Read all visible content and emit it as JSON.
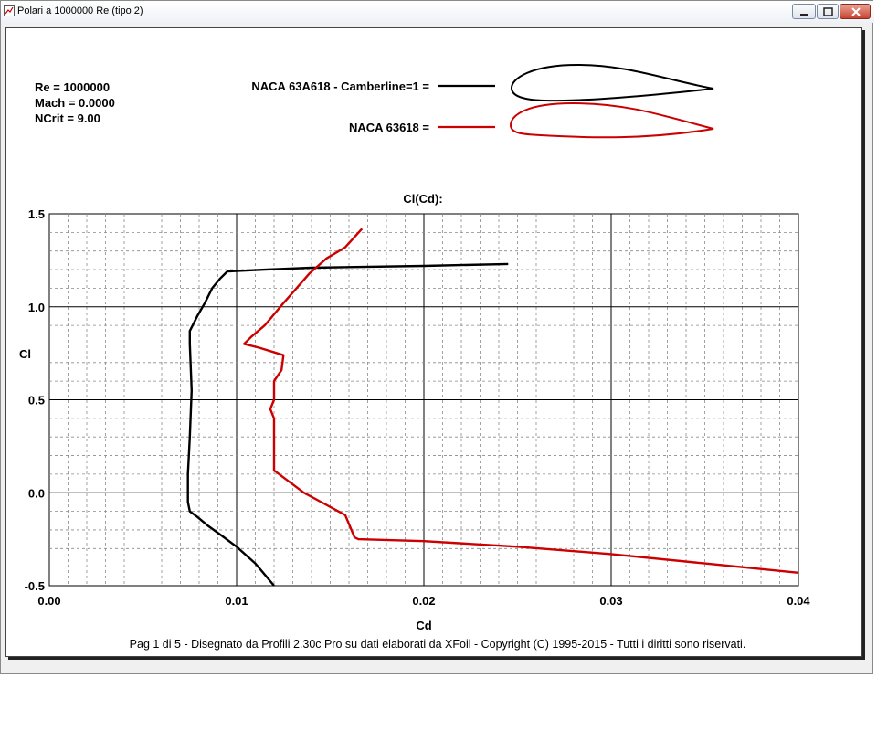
{
  "window": {
    "title": "Polari a 1000000 Re (tipo 2)",
    "controls": [
      "minimize",
      "maximize",
      "close"
    ]
  },
  "conditions": {
    "re": "Re = 1000000",
    "mach": "Mach = 0.0000",
    "ncrit": "NCrit = 9.00"
  },
  "legend": [
    {
      "label": "NACA 63A618 - Camberline=1 =",
      "color": "#000000"
    },
    {
      "label": "NACA 63618 =",
      "color": "#cc0000"
    }
  ],
  "footer": "Pag 1 di 5  -   Disegnato da Profili 2.30c Pro su dati elaborati da XFoil - Copyright (C) 1995-2015 - Tutti i diritti sono riservati.",
  "chart_data": {
    "type": "line",
    "title": "Cl(Cd):",
    "xlabel": "Cd",
    "ylabel": "Cl",
    "xlim": [
      0,
      0.04
    ],
    "ylim": [
      -0.5,
      1.5
    ],
    "x_ticks": [
      "0.00",
      "0.01",
      "0.02",
      "0.03",
      "0.04"
    ],
    "y_ticks": [
      "1.5",
      "1.0",
      "0.5",
      "0.0",
      "-0.5"
    ],
    "grid": true,
    "series": [
      {
        "name": "NACA 63A618 - Camberline=1",
        "color": "#000000",
        "points": [
          [
            0.012,
            -0.5
          ],
          [
            0.0115,
            -0.44
          ],
          [
            0.011,
            -0.38
          ],
          [
            0.01,
            -0.29
          ],
          [
            0.0092,
            -0.23
          ],
          [
            0.0085,
            -0.18
          ],
          [
            0.0079,
            -0.13
          ],
          [
            0.0075,
            -0.1
          ],
          [
            0.0074,
            -0.05
          ],
          [
            0.0074,
            0.1
          ],
          [
            0.0075,
            0.3
          ],
          [
            0.0076,
            0.55
          ],
          [
            0.0075,
            0.8
          ],
          [
            0.0075,
            0.87
          ],
          [
            0.0079,
            0.95
          ],
          [
            0.0083,
            1.02
          ],
          [
            0.0087,
            1.1
          ],
          [
            0.0091,
            1.15
          ],
          [
            0.0095,
            1.19
          ],
          [
            0.0115,
            1.2
          ],
          [
            0.014,
            1.21
          ],
          [
            0.02,
            1.22
          ],
          [
            0.0245,
            1.23
          ]
        ]
      },
      {
        "name": "NACA 63618",
        "color": "#cc0000",
        "points": [
          [
            0.04,
            -0.43
          ],
          [
            0.035,
            -0.38
          ],
          [
            0.03,
            -0.33
          ],
          [
            0.025,
            -0.29
          ],
          [
            0.02,
            -0.26
          ],
          [
            0.0165,
            -0.25
          ],
          [
            0.0163,
            -0.24
          ],
          [
            0.0158,
            -0.12
          ],
          [
            0.0147,
            -0.06
          ],
          [
            0.0136,
            0.0
          ],
          [
            0.012,
            0.12
          ],
          [
            0.012,
            0.2
          ],
          [
            0.012,
            0.4
          ],
          [
            0.0118,
            0.45
          ],
          [
            0.012,
            0.5
          ],
          [
            0.012,
            0.6
          ],
          [
            0.0124,
            0.66
          ],
          [
            0.0125,
            0.74
          ],
          [
            0.0112,
            0.78
          ],
          [
            0.0104,
            0.8
          ],
          [
            0.0108,
            0.84
          ],
          [
            0.0115,
            0.9
          ],
          [
            0.0125,
            1.02
          ],
          [
            0.0132,
            1.1
          ],
          [
            0.0139,
            1.18
          ],
          [
            0.0148,
            1.26
          ],
          [
            0.0158,
            1.32
          ],
          [
            0.0167,
            1.42
          ]
        ]
      }
    ]
  }
}
